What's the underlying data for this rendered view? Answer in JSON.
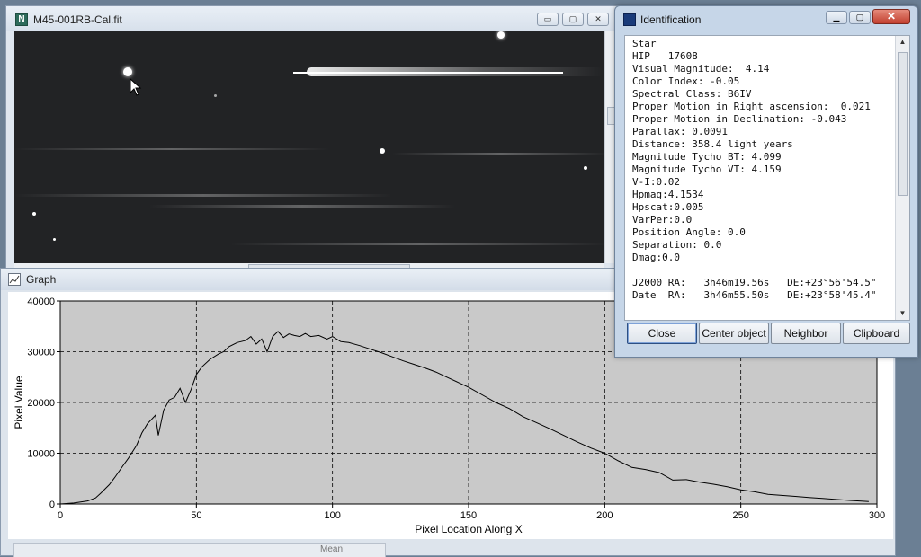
{
  "image_window": {
    "title": "M45-001RB-Cal.fit",
    "min_label": "▭",
    "max_label": "▢",
    "close_label": "✕"
  },
  "graph_window": {
    "title": "Graph",
    "bottom_label": "Mean"
  },
  "identification": {
    "title": "Identification",
    "lines": [
      "Star",
      "HIP   17608",
      "Visual Magnitude:  4.14",
      "Color Index: -0.05",
      "Spectral Class: B6IV",
      "Proper Motion in Right ascension:  0.021",
      "Proper Motion in Declination: -0.043",
      "Parallax: 0.0091",
      "Distance: 358.4 light years",
      "Magnitude Tycho BT: 4.099",
      "Magnitude Tycho VT: 4.159",
      "V-I:0.02",
      "Hpmag:4.1534",
      "Hpscat:0.005",
      "VarPer:0.0",
      "Position Angle: 0.0",
      "Separation: 0.0",
      "Dmag:0.0",
      "",
      "J2000 RA:   3h46m19.56s   DE:+23°56'54.5\"",
      "Date  RA:   3h46m55.50s   DE:+23°58'45.4\""
    ],
    "buttons": {
      "close": "Close",
      "center": "Center object",
      "neighbor": "Neighbor",
      "clipboard": "Clipboard"
    }
  },
  "chart_data": {
    "type": "line",
    "title": "",
    "xlabel": "Pixel Location Along X",
    "ylabel": "Pixel Value",
    "xlim": [
      0,
      300
    ],
    "ylim": [
      0,
      40000
    ],
    "xticks": [
      0,
      50,
      100,
      150,
      200,
      250,
      300
    ],
    "yticks": [
      0,
      10000,
      20000,
      30000,
      40000
    ],
    "grid": true,
    "x": [
      0,
      5,
      10,
      13,
      15,
      18,
      20,
      23,
      25,
      28,
      30,
      32,
      35,
      36,
      38,
      40,
      42,
      44,
      46,
      48,
      50,
      52,
      55,
      58,
      60,
      62,
      65,
      68,
      70,
      72,
      74,
      76,
      78,
      80,
      82,
      84,
      86,
      88,
      90,
      92,
      95,
      98,
      100,
      103,
      106,
      110,
      114,
      118,
      122,
      126,
      130,
      134,
      138,
      142,
      146,
      150,
      155,
      160,
      165,
      170,
      175,
      180,
      185,
      190,
      195,
      200,
      205,
      210,
      215,
      220,
      225,
      230,
      235,
      240,
      245,
      250,
      255,
      260,
      265,
      270,
      275,
      280,
      285,
      290,
      297
    ],
    "y": [
      0,
      200,
      600,
      1200,
      2200,
      3800,
      5200,
      7500,
      9000,
      11500,
      14000,
      15800,
      17500,
      13500,
      18500,
      20500,
      21000,
      22800,
      20000,
      22500,
      25500,
      27000,
      28500,
      29500,
      30000,
      31000,
      31800,
      32200,
      33000,
      31500,
      32500,
      30000,
      33000,
      34000,
      32800,
      33500,
      33200,
      33000,
      33600,
      33000,
      33200,
      32500,
      33000,
      32000,
      31800,
      31200,
      30500,
      29800,
      29000,
      28200,
      27500,
      26800,
      26000,
      25000,
      24000,
      23000,
      21500,
      20000,
      18800,
      17200,
      16000,
      14800,
      13500,
      12200,
      11000,
      10000,
      8500,
      7200,
      6800,
      6200,
      4700,
      4800,
      4300,
      3900,
      3400,
      2800,
      2400,
      1900,
      1700,
      1500,
      1300,
      1100,
      900,
      700,
      500
    ]
  },
  "colors": {
    "plot_bg": "#c9c9c9",
    "line": "#000000",
    "grid": "#000000"
  }
}
